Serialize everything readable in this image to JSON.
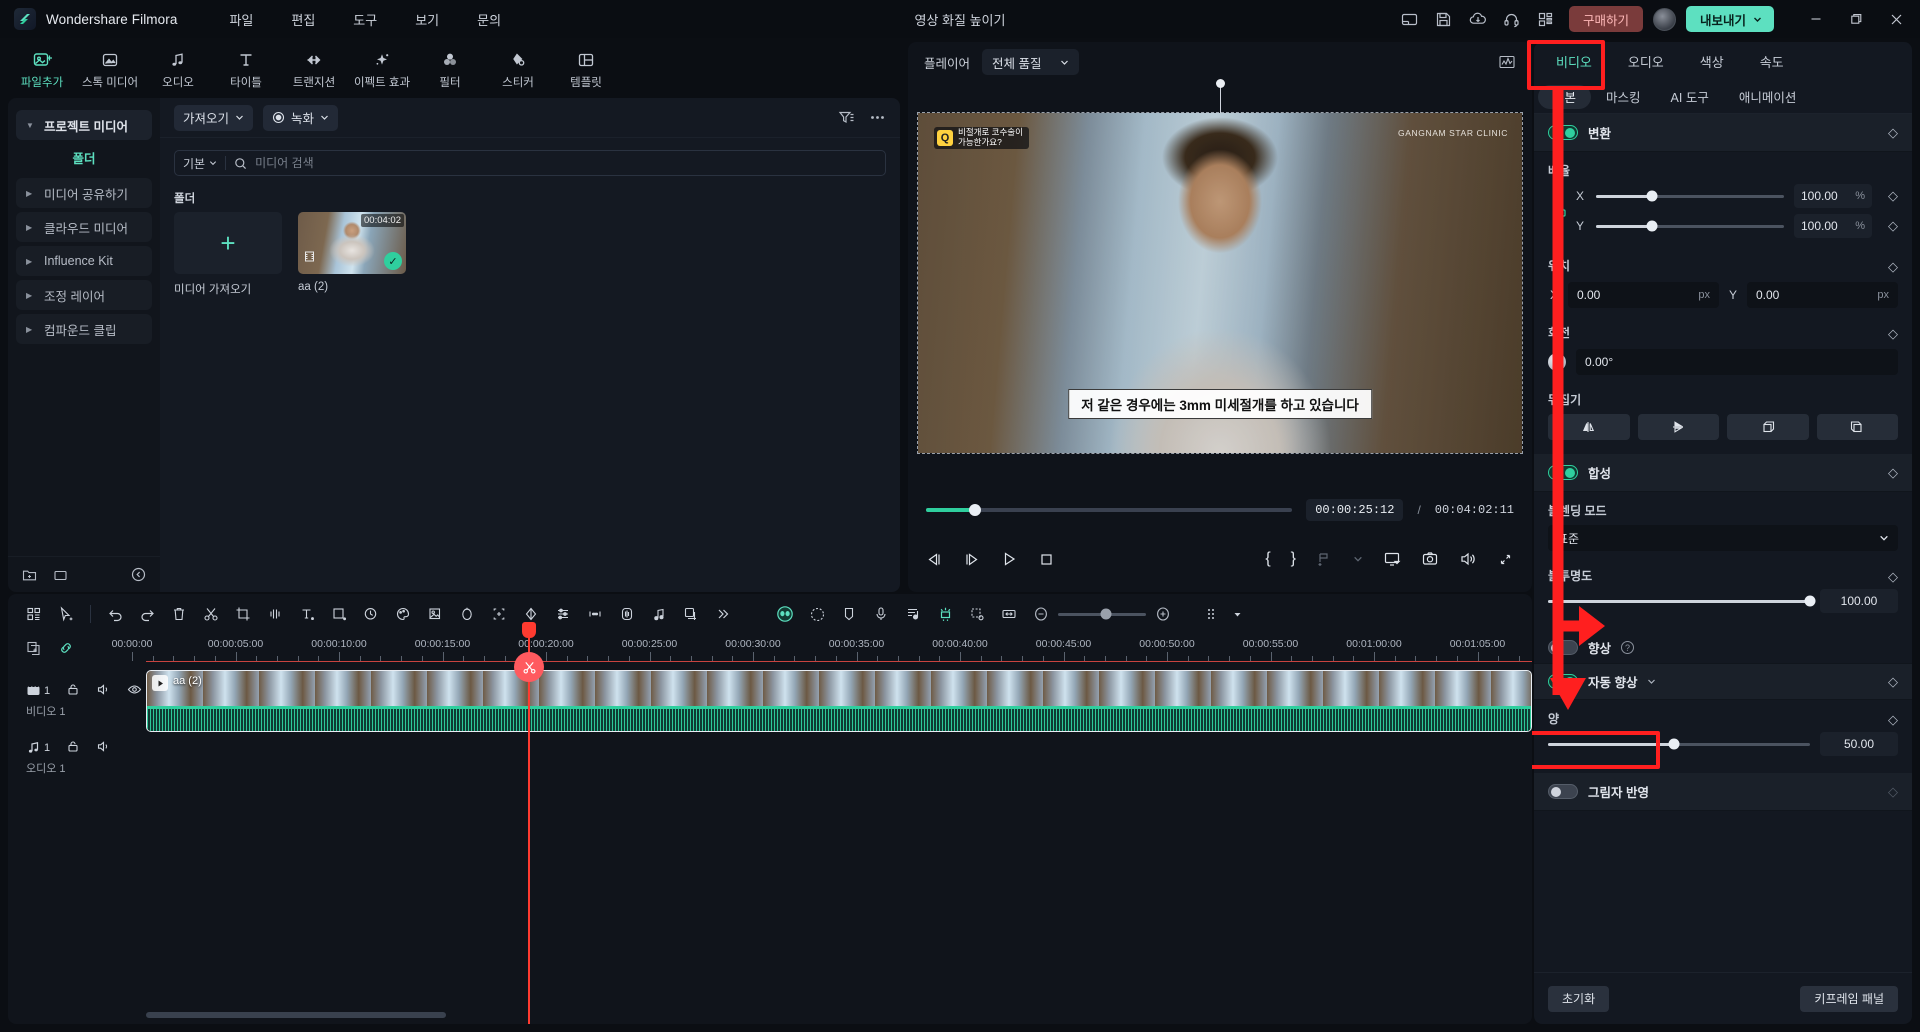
{
  "app": {
    "brand": "Wondershare Filmora",
    "document_title": "영상 화질 높이기",
    "menu": [
      "파일",
      "편집",
      "도구",
      "보기",
      "문의"
    ],
    "buy_label": "구매하기",
    "export_label": "내보내기"
  },
  "titlebar_icons": [
    {
      "name": "layout-icon"
    },
    {
      "name": "save-icon"
    },
    {
      "name": "cloud-upload-icon"
    },
    {
      "name": "headset-support-icon"
    },
    {
      "name": "apps-grid-icon"
    }
  ],
  "window_controls": {
    "minimize": "—",
    "maximize": "❐",
    "close": "✕"
  },
  "main_tabs": [
    {
      "label": "파일추가",
      "icon": "add-file-icon",
      "active": true
    },
    {
      "label": "스톡 미디어",
      "icon": "stock-media-icon",
      "active": false
    },
    {
      "label": "오디오",
      "icon": "audio-note-icon",
      "active": false
    },
    {
      "label": "타이틀",
      "icon": "title-text-icon",
      "active": false
    },
    {
      "label": "트랜지션",
      "icon": "transition-icon",
      "active": false
    },
    {
      "label": "이펙트 효과",
      "icon": "effects-sparkle-icon",
      "active": false
    },
    {
      "label": "필터",
      "icon": "filter-circles-icon",
      "active": false
    },
    {
      "label": "스티커",
      "icon": "sticker-icon",
      "active": false
    },
    {
      "label": "템플릿",
      "icon": "template-layout-icon",
      "active": false
    }
  ],
  "sidebar": {
    "items": [
      {
        "label": "프로젝트 미디어",
        "type": "panel",
        "expanded": true
      },
      {
        "label": "폴더",
        "type": "folder"
      },
      {
        "label": "미디어 공유하기",
        "type": "sub",
        "expanded": false
      },
      {
        "label": "클라우드 미디어",
        "type": "sub",
        "expanded": false
      },
      {
        "label": "Influence Kit",
        "type": "sub",
        "expanded": false
      },
      {
        "label": "조정 레이어",
        "type": "sub",
        "expanded": false
      },
      {
        "label": "컴파운드 클립",
        "type": "sub",
        "expanded": false
      }
    ],
    "bottom_icons": [
      {
        "name": "new-folder-icon"
      },
      {
        "name": "delete-folder-icon"
      },
      {
        "name": "collapse-panel-icon"
      }
    ]
  },
  "media_panel": {
    "import_button": "가져오기",
    "record_button": "녹화",
    "filter_icon": "filter-sort-icon",
    "more_icon": "more-horizontal-icon",
    "search": {
      "scope": "기본",
      "placeholder": "미디어 검색",
      "value": ""
    },
    "section_title": "폴더",
    "items": [
      {
        "type": "add",
        "label": "미디어 가져오기",
        "icon": "plus-icon"
      },
      {
        "type": "clip",
        "label": "aa (2)",
        "duration": "00:04:02",
        "selected": true
      }
    ]
  },
  "player": {
    "label": "플레이어",
    "quality": "전체 품질",
    "analytics_icon": "waveform-graph-icon",
    "current_time": "00:00:25:12",
    "separator": "/",
    "total_time": "00:04:02:11",
    "progress_percent": 13.5,
    "overlay": {
      "badge_letter": "Q",
      "badge_text_line1": "비절개로 코수술이",
      "badge_text_line2": "가능한가요?",
      "watermark": "GANGNAM STAR CLINIC",
      "subtitle": "저 같은 경우에는 3mm 미세절개를 하고 있습니다"
    },
    "controls": [
      {
        "name": "prev-frame-button"
      },
      {
        "name": "next-frame-button"
      },
      {
        "name": "play-button"
      },
      {
        "name": "stop-button"
      },
      {
        "name": "mark-in-button",
        "glyph": "{"
      },
      {
        "name": "mark-out-button",
        "glyph": "}"
      },
      {
        "name": "add-marker-button"
      },
      {
        "name": "marker-dropdown-button"
      },
      {
        "name": "display-settings-button"
      },
      {
        "name": "snapshot-button"
      },
      {
        "name": "volume-button"
      },
      {
        "name": "fullscreen-button"
      }
    ]
  },
  "properties": {
    "tabs": [
      {
        "label": "비디오",
        "active": true
      },
      {
        "label": "오디오",
        "active": false
      },
      {
        "label": "색상",
        "active": false
      },
      {
        "label": "속도",
        "active": false
      }
    ],
    "subtabs": [
      {
        "label": "기본",
        "active": true
      },
      {
        "label": "마스킹",
        "active": false
      },
      {
        "label": "AI 도구",
        "active": false
      },
      {
        "label": "애니메이션",
        "active": false
      }
    ],
    "transform": {
      "title": "변환",
      "enabled": true,
      "scale_label": "배율",
      "scale_x_label": "X",
      "scale_x_value": "100.00",
      "scale_x_unit": "%",
      "scale_y_label": "Y",
      "scale_y_value": "100.00",
      "scale_y_unit": "%",
      "position_label": "위치",
      "pos_x_label": "X",
      "pos_x_value": "0.00",
      "pos_x_unit": "px",
      "pos_y_label": "Y",
      "pos_y_value": "0.00",
      "pos_y_unit": "px",
      "rotation_label": "회전",
      "rotation_value": "0.00°",
      "flip_label": "뒤집기",
      "flip_buttons": [
        {
          "name": "flip-horizontal-button"
        },
        {
          "name": "flip-vertical-button"
        },
        {
          "name": "rotate-cw-button"
        },
        {
          "name": "rotate-ccw-button"
        }
      ]
    },
    "compositing": {
      "title": "합성",
      "enabled": true,
      "blend_label": "블렌딩 모드",
      "blend_value": "표준",
      "opacity_label": "불투명도",
      "opacity_value": "100.00",
      "opacity_percent": 100
    },
    "enhance": {
      "hidden_row_label": "향상",
      "hidden_row_enabled": false,
      "auto_label": "자동 향상",
      "auto_enabled": true,
      "amount_label": "양",
      "amount_value": "50.00",
      "amount_percent": 48
    },
    "drop_shadow": {
      "label": "그림자 반영",
      "enabled": false
    },
    "footer": {
      "reset": "초기화",
      "keyframe_panel": "키프레임 패널"
    }
  },
  "timeline": {
    "tools_left": [
      {
        "name": "grid-view-button"
      },
      {
        "name": "select-tool-button"
      },
      {
        "name": "undo-button"
      },
      {
        "name": "redo-button"
      },
      {
        "name": "delete-button"
      },
      {
        "name": "split-scissors-button"
      },
      {
        "name": "crop-button"
      },
      {
        "name": "audio-detach-button"
      },
      {
        "name": "add-text-button"
      },
      {
        "name": "mask-button"
      },
      {
        "name": "speed-ramp-button"
      },
      {
        "name": "color-palette-button"
      },
      {
        "name": "green-screen-button"
      },
      {
        "name": "stabilize-button"
      },
      {
        "name": "auto-reframe-button"
      },
      {
        "name": "keyframe-diamond-button"
      },
      {
        "name": "audio-mixer-button"
      },
      {
        "name": "silence-detect-button"
      },
      {
        "name": "audio-ducking-button"
      },
      {
        "name": "beat-detect-button"
      },
      {
        "name": "render-preview-button"
      },
      {
        "name": "more-tools-button"
      }
    ],
    "tools_right": [
      {
        "name": "ai-smart-mask-button"
      },
      {
        "name": "motion-tracking-button"
      },
      {
        "name": "marker-button"
      },
      {
        "name": "voiceover-mic-button"
      },
      {
        "name": "audio-levels-button"
      },
      {
        "name": "ai-highlight-button"
      },
      {
        "name": "snapshot-track-button"
      },
      {
        "name": "fit-timeline-button"
      },
      {
        "name": "zoom-out-button"
      },
      {
        "name": "zoom-in-button"
      },
      {
        "name": "track-options-button"
      }
    ],
    "head_icons": [
      {
        "name": "add-track-icon"
      },
      {
        "name": "link-clips-icon"
      }
    ],
    "ruler_labels": [
      "00:00:00",
      "00:00:05:00",
      "00:00:10:00",
      "00:00:15:00",
      "00:00:20:00",
      "00:00:25:00",
      "00:00:30:00",
      "00:00:35:00",
      "00:00:40:00",
      "00:00:45:00",
      "00:00:50:00",
      "00:00:55:00",
      "00:01:00:00",
      "00:01:05:00"
    ],
    "tracks": [
      {
        "kind": "video",
        "index": "1",
        "name": "비디오 1",
        "icons": [
          "video-track-icon",
          "lock-icon",
          "mute-icon",
          "eye-icon"
        ]
      },
      {
        "kind": "audio",
        "index": "1",
        "name": "오디오 1",
        "icons": [
          "audio-track-icon",
          "lock-icon",
          "mute-icon"
        ]
      }
    ],
    "clip": {
      "name": "aa (2)"
    },
    "playhead_time": "00:00:25:12"
  },
  "annotations": {
    "highlight_color": "#ff1f1f",
    "boxes": [
      {
        "name": "video-tab-highlight"
      },
      {
        "name": "auto-enhance-highlight"
      }
    ],
    "arrow": {
      "name": "red-down-arrow"
    }
  }
}
